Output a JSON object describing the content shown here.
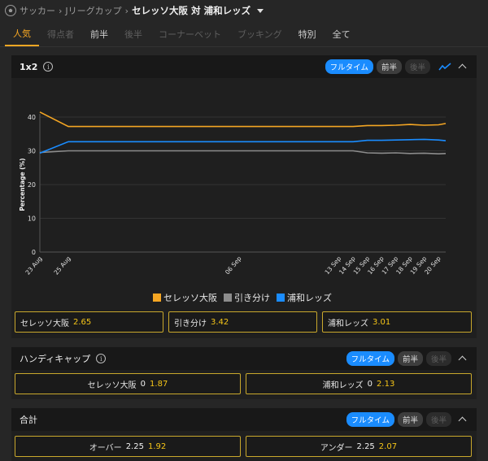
{
  "breadcrumb": {
    "crumb1": "サッカー",
    "crumb2": "Jリーグカップ",
    "current": "セレッソ大阪 対 浦和レッズ"
  },
  "tabs": [
    {
      "label": "人気",
      "state": "active"
    },
    {
      "label": "得点者",
      "state": "disabled"
    },
    {
      "label": "前半",
      "state": "normal"
    },
    {
      "label": "後半",
      "state": "disabled"
    },
    {
      "label": "コーナーベット",
      "state": "disabled"
    },
    {
      "label": "ブッキング",
      "state": "disabled"
    },
    {
      "label": "特別",
      "state": "normal"
    },
    {
      "label": "全て",
      "state": "normal"
    }
  ],
  "panel1x2": {
    "title": "1x2",
    "pills": [
      "フルタイム",
      "前半",
      "後半"
    ],
    "odds": [
      {
        "label": "セレッソ大阪",
        "value": "2.65"
      },
      {
        "label": "引き分け",
        "value": "3.42"
      },
      {
        "label": "浦和レッズ",
        "value": "3.01"
      }
    ]
  },
  "handicap": {
    "title": "ハンディキャップ",
    "pills": [
      "フルタイム",
      "前半",
      "後半"
    ],
    "odds": [
      {
        "label": "セレッソ大阪",
        "line": "0",
        "value": "1.87"
      },
      {
        "label": "浦和レッズ",
        "line": "0",
        "value": "2.13"
      }
    ]
  },
  "total": {
    "title": "合計",
    "pills": [
      "フルタイム",
      "前半",
      "後半"
    ],
    "odds": [
      {
        "label": "オーバー",
        "line": "2.25",
        "value": "1.92"
      },
      {
        "label": "アンダー",
        "line": "2.25",
        "value": "2.07"
      }
    ]
  },
  "colors": {
    "accent": "#f5a623",
    "blue": "#1a8cff",
    "odds_border": "#c9a82c",
    "odds_value": "#f5c518"
  },
  "chart_data": {
    "type": "line",
    "ylabel": "Percentage (%)",
    "ylim": [
      0,
      40
    ],
    "yticks": [
      0,
      10,
      20,
      30,
      40
    ],
    "xticks": [
      {
        "label": "23 Aug",
        "day": 0
      },
      {
        "label": "25 Aug",
        "day": 2
      },
      {
        "label": "06 Sep",
        "day": 14
      },
      {
        "label": "13 Sep",
        "day": 21
      },
      {
        "label": "14 Sep",
        "day": 22
      },
      {
        "label": "15 Sep",
        "day": 23
      },
      {
        "label": "16 Sep",
        "day": 24
      },
      {
        "label": "17 Sep",
        "day": 25
      },
      {
        "label": "18 Sep",
        "day": 26
      },
      {
        "label": "19 Sep",
        "day": 27
      },
      {
        "label": "20 Sep",
        "day": 28
      }
    ],
    "series": [
      {
        "name": "セレッソ大阪",
        "color": "#f5a623",
        "points": [
          [
            0,
            41.5
          ],
          [
            2,
            37.2
          ],
          [
            14,
            37.2
          ],
          [
            21,
            37.2
          ],
          [
            22,
            37.2
          ],
          [
            23,
            37.5
          ],
          [
            24,
            37.5
          ],
          [
            25,
            37.6
          ],
          [
            26,
            37.8
          ],
          [
            27,
            37.6
          ],
          [
            28,
            37.7
          ],
          [
            28.5,
            38.1
          ]
        ]
      },
      {
        "name": "引き分け",
        "color": "#8c8c8c",
        "points": [
          [
            0,
            29.5
          ],
          [
            2,
            30.0
          ],
          [
            14,
            30.0
          ],
          [
            21,
            30.0
          ],
          [
            22,
            30.0
          ],
          [
            23,
            29.4
          ],
          [
            24,
            29.3
          ],
          [
            25,
            29.4
          ],
          [
            26,
            29.2
          ],
          [
            27,
            29.3
          ],
          [
            28,
            29.1
          ],
          [
            28.5,
            29.2
          ]
        ]
      },
      {
        "name": "浦和レッズ",
        "color": "#1a8cff",
        "points": [
          [
            0,
            29.3
          ],
          [
            2,
            32.7
          ],
          [
            14,
            32.7
          ],
          [
            21,
            32.7
          ],
          [
            22,
            32.7
          ],
          [
            23,
            33.1
          ],
          [
            24,
            33.1
          ],
          [
            25,
            33.2
          ],
          [
            26,
            33.3
          ],
          [
            27,
            33.4
          ],
          [
            28,
            33.2
          ],
          [
            28.5,
            33.0
          ]
        ]
      }
    ]
  }
}
